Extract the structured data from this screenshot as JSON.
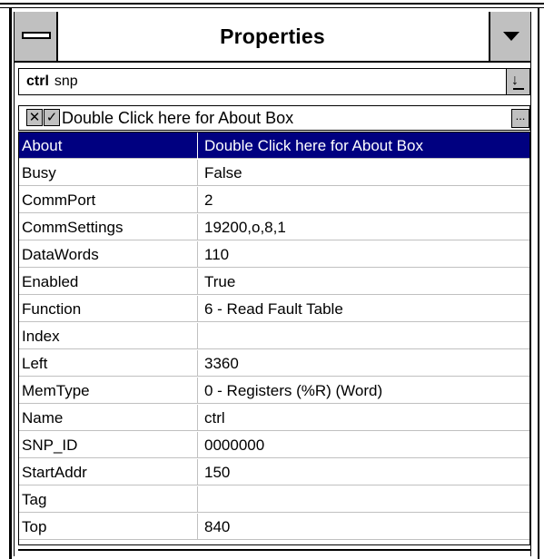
{
  "window": {
    "title": "Properties"
  },
  "object_selector": {
    "name": "ctrl",
    "type": "snp"
  },
  "edit_bar": {
    "cancel_glyph": "✕",
    "accept_glyph": "✓",
    "value": "Double Click here for About Box",
    "more_label": "..."
  },
  "properties": [
    {
      "name": "About",
      "value": "Double Click here for About Box",
      "selected": true
    },
    {
      "name": "Busy",
      "value": "False"
    },
    {
      "name": "CommPort",
      "value": "2"
    },
    {
      "name": "CommSettings",
      "value": "19200,o,8,1"
    },
    {
      "name": "DataWords",
      "value": "110"
    },
    {
      "name": "Enabled",
      "value": "True"
    },
    {
      "name": "Function",
      "value": "6 - Read Fault Table"
    },
    {
      "name": "Index",
      "value": ""
    },
    {
      "name": "Left",
      "value": "3360"
    },
    {
      "name": "MemType",
      "value": "0 - Registers (%R) (Word)"
    },
    {
      "name": "Name",
      "value": "ctrl"
    },
    {
      "name": "SNP_ID",
      "value": "0000000"
    },
    {
      "name": "StartAddr",
      "value": "150"
    },
    {
      "name": "Tag",
      "value": ""
    },
    {
      "name": "Top",
      "value": "840"
    }
  ],
  "colors": {
    "selection": "#000080",
    "button_face": "#c0c0c0"
  },
  "icons": [
    "system-menu-icon",
    "dropdown-arrow-icon",
    "combo-down-arrow-icon",
    "cancel-icon",
    "accept-icon",
    "ellipsis-icon"
  ]
}
